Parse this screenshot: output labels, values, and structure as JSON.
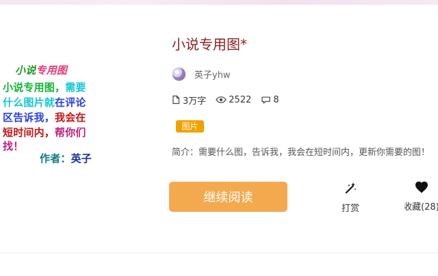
{
  "cover": {
    "title_part1": "小说",
    "title_part2": "专用图",
    "line1_a": "小说专用图，",
    "line1_b": "需要",
    "line2_a": "什么图片就",
    "line2_b": "在评论",
    "line3_a": "区告诉我，",
    "line3_b": "我会在",
    "line4_a": "短时间内，",
    "line4_b": "帮你们",
    "line5": "找！",
    "author_label": "作者：",
    "author_name": "英子"
  },
  "book": {
    "title": "小说专用图*",
    "author": "英子yhw",
    "word_count": "3万字",
    "views": "2522",
    "comments": "8",
    "tag": "图片",
    "intro": "简介：需要什么图，告诉我，我会在短时间内，更新你需要的图！"
  },
  "actions": {
    "read_button": "继续阅读",
    "reward_label": "打赏",
    "favorite_label": "收藏(28)"
  },
  "icons": {
    "document": "document-icon",
    "views": "eye-icon",
    "comments": "comment-icon",
    "reward": "magic-wand-icon",
    "favorite": "heart-icon"
  },
  "colors": {
    "title": "#8a1f1f",
    "tag_bg": "#f2a200",
    "button_bg": "#f3aa4f"
  }
}
